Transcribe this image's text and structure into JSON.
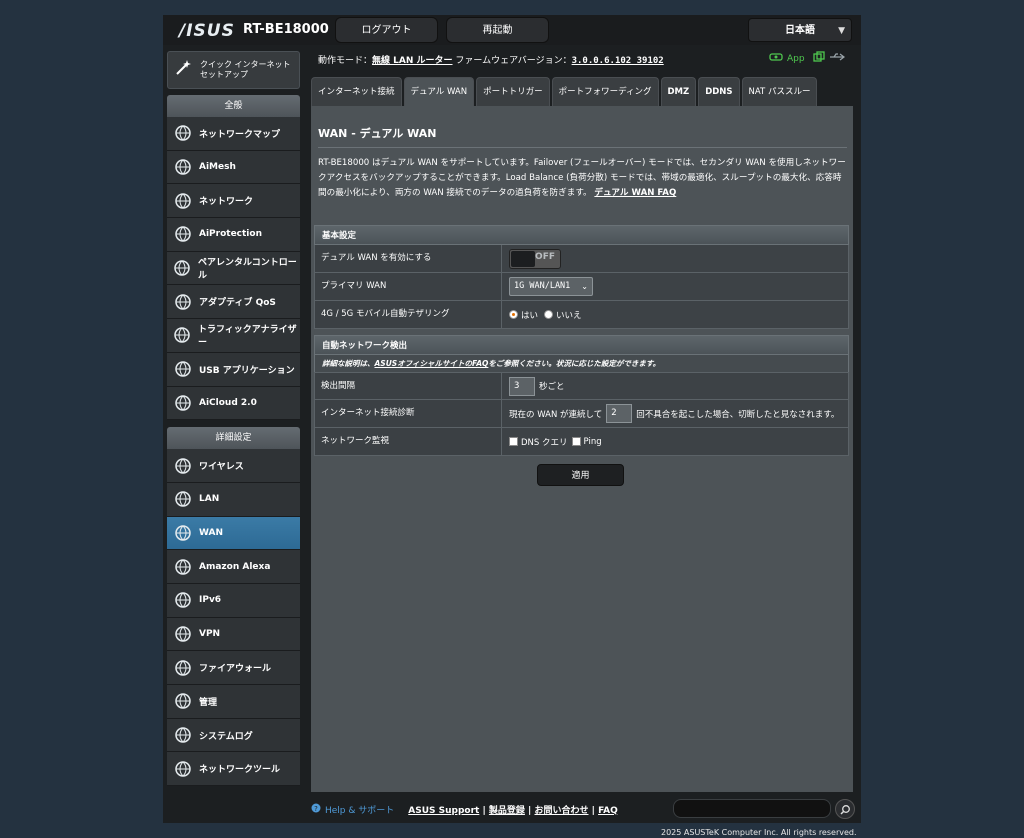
{
  "header": {
    "brand": "/ISUS",
    "model": "RT-BE18000",
    "logout_label": "ログアウト",
    "reboot_label": "再起動",
    "language": "日本語"
  },
  "status": {
    "mode_label": "動作モード：",
    "mode_value": "無線 LAN ルーター",
    "firmware_label": "ファームウェアバージョン：",
    "firmware_value": "3.0.0.6.102_39102",
    "app_label": "App"
  },
  "sidebar": {
    "qis_label": "クイック インターネット セットアップ",
    "general_header": "全般",
    "general_items": [
      {
        "label": "ネットワークマップ",
        "icon": "network-map-icon"
      },
      {
        "label": "AiMesh",
        "icon": "aimesh-icon"
      },
      {
        "label": "ネットワーク",
        "icon": "globe-icon"
      },
      {
        "label": "AiProtection",
        "icon": "shield-icon"
      },
      {
        "label": "ペアレンタルコントロール",
        "icon": "family-icon"
      },
      {
        "label": "アダプティブ QoS",
        "icon": "gauge-icon"
      },
      {
        "label": "トラフィックアナライザー",
        "icon": "traffic-icon"
      },
      {
        "label": "USB アプリケーション",
        "icon": "usb-icon"
      },
      {
        "label": "AiCloud 2.0",
        "icon": "cloud-icon"
      }
    ],
    "advanced_header": "詳細設定",
    "advanced_items": [
      {
        "label": "ワイヤレス",
        "icon": "wifi-icon"
      },
      {
        "label": "LAN",
        "icon": "lan-icon"
      },
      {
        "label": "WAN",
        "icon": "wan-globe-icon"
      },
      {
        "label": "Amazon Alexa",
        "icon": "alexa-icon"
      },
      {
        "label": "IPv6",
        "icon": "ipv6-icon"
      },
      {
        "label": "VPN",
        "icon": "vpn-icon"
      },
      {
        "label": "ファイアウォール",
        "icon": "firewall-icon"
      },
      {
        "label": "管理",
        "icon": "admin-gear-icon"
      },
      {
        "label": "システムログ",
        "icon": "syslog-icon"
      },
      {
        "label": "ネットワークツール",
        "icon": "tools-icon"
      }
    ]
  },
  "tabs": [
    {
      "label": "インターネット接続",
      "bold": false
    },
    {
      "label": "デュアル WAN",
      "bold": false
    },
    {
      "label": "ポートトリガー",
      "bold": false
    },
    {
      "label": "ポートフォワーディング",
      "bold": false
    },
    {
      "label": "DMZ",
      "bold": true
    },
    {
      "label": "DDNS",
      "bold": true
    },
    {
      "label": "NAT パススルー",
      "bold": false
    }
  ],
  "panel": {
    "title": "WAN - デュアル WAN",
    "description": "RT-BE18000 はデュアル WAN をサポートしています。Failover (フェールオーバー) モードでは、セカンダリ WAN を使用しネットワークアクセスをバックアップすることができます。Load Balance (負荷分散) モードでは、帯域の最適化、スループットの最大化、応答時間の最小化により、両方の WAN 接続でのデータの過負荷を防ぎます。",
    "faq_link": "デュアル WAN FAQ",
    "basic": {
      "header": "基本設定",
      "enable_label": "デュアル WAN を有効にする",
      "enable_state": "OFF",
      "primary_label": "プライマリ WAN",
      "primary_value": "1G WAN/LAN1",
      "mobile_label": "4G / 5G モバイル自動テザリング",
      "mobile_yes": "はい",
      "mobile_no": "いいえ"
    },
    "detect": {
      "header": "自動ネットワーク検出",
      "note_prefix": "詳細な説明は、",
      "note_link": "ASUSオフィシャルサイトのFAQ",
      "note_suffix": "をご参照ください。状況に応じた設定ができます。",
      "interval_label": "検出間隔",
      "interval_value": "3",
      "interval_unit": "秒ごと",
      "diag_label": "インターネット接続診断",
      "diag_prefix": "現在の WAN が連続して",
      "diag_value": "2",
      "diag_suffix": "回不具合を起こした場合、切断したと見なされます。",
      "monitor_label": "ネットワーク監視",
      "dns_label": "DNS クエリ",
      "ping_label": "Ping"
    },
    "apply_label": "適用"
  },
  "footer": {
    "help": "Help & サポート",
    "support": "ASUS Support",
    "register": "製品登録",
    "contact": "お問い合わせ",
    "faq": "FAQ",
    "copyright": "2025 ASUSTeK Computer Inc. All rights reserved."
  }
}
